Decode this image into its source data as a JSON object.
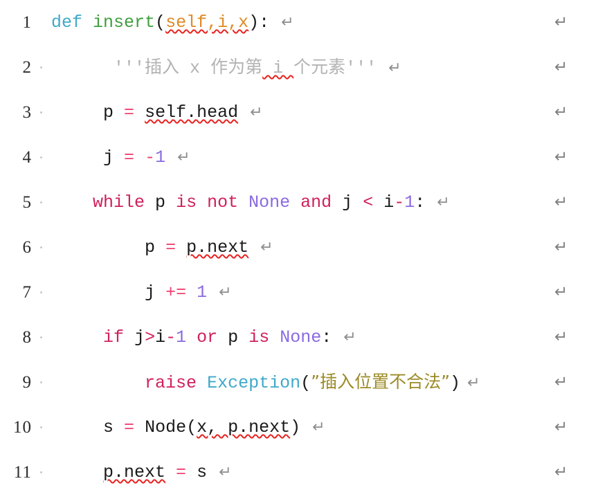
{
  "document": {
    "type": "code-listing",
    "language": "Python",
    "background_color": "#ffffff",
    "show_line_numbers": true,
    "show_paragraph_marks": true,
    "show_spellcheck_squiggles": true,
    "end_of_line_symbol": "↵",
    "indent_dot_symbol": "·"
  },
  "colors": {
    "keyword": "#d1205a",
    "def_keyword": "#3fa9c9",
    "function_name": "#3f9f3f",
    "parameter": "#e08a25",
    "constant": "#8a6ae0",
    "operator": "#ef4070",
    "plain": "#1a1a1a",
    "comment": "#b3b3b3",
    "string": "#9c8b28",
    "class_name": "#3fa9c9",
    "spellcheck_underline": "#e8221f",
    "line_number": "#2b2b2b",
    "return_mark": "#8c8c8c"
  },
  "lines": [
    {
      "number": "1",
      "indent_dot": false,
      "plain_text": "def insert(self,i,x): ↵",
      "tokens": [
        {
          "text": "def",
          "style": "def"
        },
        {
          "text": " ",
          "style": "plain"
        },
        {
          "text": "insert",
          "style": "fname"
        },
        {
          "text": "(",
          "style": "plain"
        },
        {
          "text": "self,i,x",
          "style": "param",
          "squiggle": true
        },
        {
          "text": ")",
          "style": "plain"
        },
        {
          "text": ":",
          "style": "plain"
        },
        {
          "text": " ↵",
          "style": "ret"
        }
      ]
    },
    {
      "number": "2",
      "indent_dot": true,
      "plain_text": "    '''插入 x 作为第 i 个元素''' ↵",
      "tokens": [
        {
          "text": "      ",
          "style": "plain"
        },
        {
          "text": "'''",
          "style": "comment"
        },
        {
          "text": "插入",
          "style": "comment",
          "cjk": true
        },
        {
          "text": " x ",
          "style": "comment"
        },
        {
          "text": "作为第",
          "style": "comment",
          "cjk": true
        },
        {
          "text": " i ",
          "style": "comment",
          "squiggle": true
        },
        {
          "text": "个元素",
          "style": "comment",
          "cjk": true
        },
        {
          "text": "'''",
          "style": "comment"
        },
        {
          "text": " ↵",
          "style": "ret"
        }
      ]
    },
    {
      "number": "3",
      "indent_dot": true,
      "plain_text": "    p = self.head ↵",
      "tokens": [
        {
          "text": "     ",
          "style": "plain"
        },
        {
          "text": "p",
          "style": "plain"
        },
        {
          "text": " ",
          "style": "plain"
        },
        {
          "text": "=",
          "style": "op"
        },
        {
          "text": " ",
          "style": "plain"
        },
        {
          "text": "self.head",
          "style": "plain",
          "squiggle": true
        },
        {
          "text": " ↵",
          "style": "ret"
        }
      ]
    },
    {
      "number": "4",
      "indent_dot": true,
      "plain_text": "    j = -1 ↵",
      "tokens": [
        {
          "text": "     ",
          "style": "plain"
        },
        {
          "text": "j",
          "style": "plain"
        },
        {
          "text": " ",
          "style": "plain"
        },
        {
          "text": "=",
          "style": "op"
        },
        {
          "text": " ",
          "style": "plain"
        },
        {
          "text": "-",
          "style": "op"
        },
        {
          "text": "1",
          "style": "const"
        },
        {
          "text": " ↵",
          "style": "ret"
        }
      ]
    },
    {
      "number": "5",
      "indent_dot": true,
      "plain_text": "    while p is not None and j < i-1: ↵",
      "tokens": [
        {
          "text": "    ",
          "style": "plain"
        },
        {
          "text": "while",
          "style": "kw"
        },
        {
          "text": " ",
          "style": "plain"
        },
        {
          "text": "p",
          "style": "plain"
        },
        {
          "text": " ",
          "style": "plain"
        },
        {
          "text": "is not",
          "style": "kw"
        },
        {
          "text": " ",
          "style": "plain"
        },
        {
          "text": "None",
          "style": "const"
        },
        {
          "text": " ",
          "style": "plain"
        },
        {
          "text": "and",
          "style": "kw"
        },
        {
          "text": " ",
          "style": "plain"
        },
        {
          "text": "j",
          "style": "plain"
        },
        {
          "text": " ",
          "style": "plain"
        },
        {
          "text": "<",
          "style": "kw"
        },
        {
          "text": " ",
          "style": "plain"
        },
        {
          "text": "i",
          "style": "plain"
        },
        {
          "text": "-",
          "style": "kw"
        },
        {
          "text": "1",
          "style": "const"
        },
        {
          "text": ":",
          "style": "plain"
        },
        {
          "text": " ↵",
          "style": "ret"
        }
      ]
    },
    {
      "number": "6",
      "indent_dot": true,
      "plain_text": "        p = p.next ↵",
      "tokens": [
        {
          "text": "         ",
          "style": "plain"
        },
        {
          "text": "p",
          "style": "plain"
        },
        {
          "text": " ",
          "style": "plain"
        },
        {
          "text": "=",
          "style": "op"
        },
        {
          "text": " ",
          "style": "plain"
        },
        {
          "text": "p.next",
          "style": "plain",
          "squiggle": true
        },
        {
          "text": " ↵",
          "style": "ret"
        }
      ]
    },
    {
      "number": "7",
      "indent_dot": true,
      "plain_text": "        j += 1 ↵",
      "tokens": [
        {
          "text": "         ",
          "style": "plain"
        },
        {
          "text": "j",
          "style": "plain"
        },
        {
          "text": " ",
          "style": "plain"
        },
        {
          "text": "+=",
          "style": "op"
        },
        {
          "text": " ",
          "style": "plain"
        },
        {
          "text": "1",
          "style": "const"
        },
        {
          "text": " ↵",
          "style": "ret"
        }
      ]
    },
    {
      "number": "8",
      "indent_dot": true,
      "plain_text": "    if j>i-1 or p is None: ↵",
      "tokens": [
        {
          "text": "     ",
          "style": "plain"
        },
        {
          "text": "if",
          "style": "kw"
        },
        {
          "text": " ",
          "style": "plain"
        },
        {
          "text": "j",
          "style": "plain"
        },
        {
          "text": ">",
          "style": "kw"
        },
        {
          "text": "i",
          "style": "plain"
        },
        {
          "text": "-",
          "style": "kw"
        },
        {
          "text": "1",
          "style": "const"
        },
        {
          "text": " ",
          "style": "plain"
        },
        {
          "text": "or",
          "style": "kw"
        },
        {
          "text": " ",
          "style": "plain"
        },
        {
          "text": "p",
          "style": "plain"
        },
        {
          "text": " ",
          "style": "plain"
        },
        {
          "text": "is",
          "style": "kw"
        },
        {
          "text": " ",
          "style": "plain"
        },
        {
          "text": "None",
          "style": "const"
        },
        {
          "text": ":",
          "style": "plain"
        },
        {
          "text": " ↵",
          "style": "ret"
        }
      ]
    },
    {
      "number": "9",
      "indent_dot": true,
      "plain_text": "        raise Exception(\"插入位置不合法\")↵",
      "tokens": [
        {
          "text": "         ",
          "style": "plain"
        },
        {
          "text": "raise",
          "style": "kw"
        },
        {
          "text": " ",
          "style": "plain"
        },
        {
          "text": "Exception",
          "style": "cls"
        },
        {
          "text": "(",
          "style": "plain"
        },
        {
          "text": "”",
          "style": "str",
          "cjk": true
        },
        {
          "text": "插入位置不合法",
          "style": "str",
          "cjk": true
        },
        {
          "text": "”",
          "style": "str",
          "cjk": true
        },
        {
          "text": ")",
          "style": "plain"
        },
        {
          "text": "↵",
          "style": "ret"
        }
      ]
    },
    {
      "number": "10",
      "indent_dot": true,
      "plain_text": "    s = Node(x, p.next) ↵",
      "tokens": [
        {
          "text": "     ",
          "style": "plain"
        },
        {
          "text": "s",
          "style": "plain"
        },
        {
          "text": " ",
          "style": "plain"
        },
        {
          "text": "=",
          "style": "op"
        },
        {
          "text": " ",
          "style": "plain"
        },
        {
          "text": "Node",
          "style": "plain"
        },
        {
          "text": "(",
          "style": "plain"
        },
        {
          "text": "x, p.next",
          "style": "plain",
          "squiggle": true
        },
        {
          "text": ")",
          "style": "plain"
        },
        {
          "text": " ↵",
          "style": "ret"
        }
      ]
    },
    {
      "number": "11",
      "indent_dot": true,
      "plain_text": "    p.next = s ↵",
      "tokens": [
        {
          "text": "     ",
          "style": "plain"
        },
        {
          "text": "p.next",
          "style": "plain",
          "squiggle": true
        },
        {
          "text": " ",
          "style": "plain"
        },
        {
          "text": "=",
          "style": "op"
        },
        {
          "text": " ",
          "style": "plain"
        },
        {
          "text": "s",
          "style": "plain"
        },
        {
          "text": " ↵",
          "style": "ret"
        }
      ]
    }
  ],
  "margin_return_marks": [
    "↵",
    "↵",
    "↵",
    "↵",
    "↵",
    "↵",
    "↵",
    "↵",
    "↵",
    "↵",
    "↵"
  ]
}
